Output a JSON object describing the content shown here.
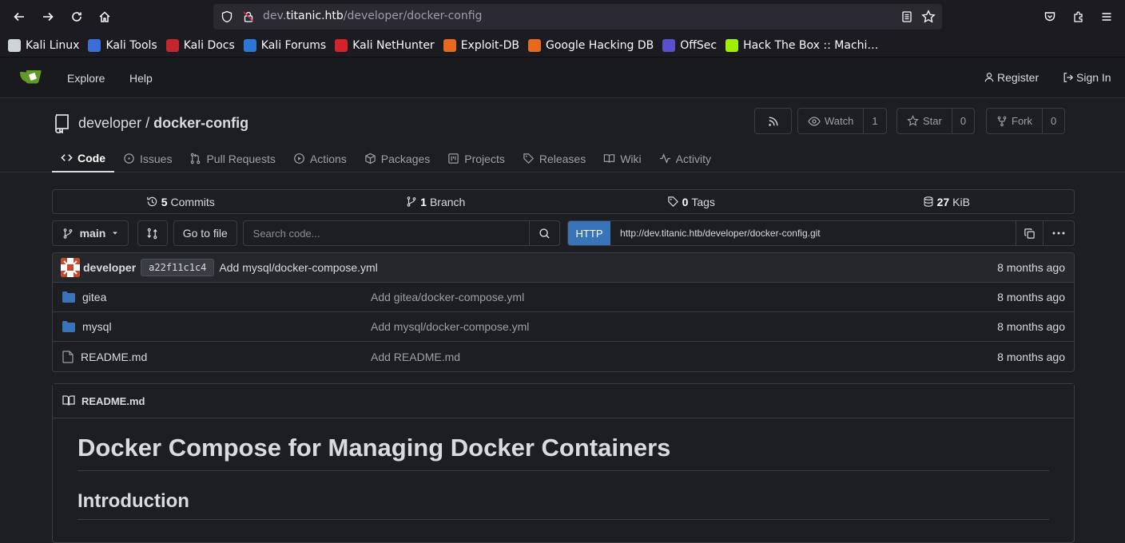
{
  "browser": {
    "url_prefix": "dev.",
    "url_host": "titanic.htb",
    "url_path": "/developer/docker-config",
    "bookmarks": [
      {
        "label": "Kali Linux",
        "icon": "kali-dragon-icon",
        "color": "#cfd2d6"
      },
      {
        "label": "Kali Tools",
        "icon": "kali-tools-icon",
        "color": "#3b6fd8"
      },
      {
        "label": "Kali Docs",
        "icon": "kali-docs-icon",
        "color": "#c1272d"
      },
      {
        "label": "Kali Forums",
        "icon": "kali-forums-icon",
        "color": "#2a78d6"
      },
      {
        "label": "Kali NetHunter",
        "icon": "kali-nethunter-icon",
        "color": "#d3222a"
      },
      {
        "label": "Exploit-DB",
        "icon": "exploit-db-icon",
        "color": "#e66a1a"
      },
      {
        "label": "Google Hacking DB",
        "icon": "ghdb-icon",
        "color": "#e66a1a"
      },
      {
        "label": "OffSec",
        "icon": "offsec-icon",
        "color": "#5a4fcf"
      },
      {
        "label": "Hack The Box :: Machi…",
        "icon": "htb-icon",
        "color": "#9fef00"
      }
    ]
  },
  "gitea": {
    "nav": {
      "explore": "Explore",
      "help": "Help",
      "register": "Register",
      "signin": "Sign In"
    },
    "repo": {
      "owner": "developer",
      "separator": "/",
      "name": "docker-config",
      "watch_label": "Watch",
      "watch_count": "1",
      "star_label": "Star",
      "star_count": "0",
      "fork_label": "Fork",
      "fork_count": "0"
    },
    "tabs": [
      "Code",
      "Issues",
      "Pull Requests",
      "Actions",
      "Packages",
      "Projects",
      "Releases",
      "Wiki",
      "Activity"
    ],
    "stats": {
      "commits_num": "5",
      "commits_label": "Commits",
      "branch_num": "1",
      "branch_label": "Branch",
      "tags_num": "0",
      "tags_label": "Tags",
      "size_num": "27",
      "size_label": "KiB"
    },
    "toolbar": {
      "branch": "main",
      "goto_file": "Go to file",
      "search_placeholder": "Search code...",
      "protocol": "HTTP",
      "clone_url": "http://dev.titanic.htb/developer/docker-config.git"
    },
    "latest_commit": {
      "author": "developer",
      "sha": "a22f11c1c4",
      "message": "Add mysql/docker-compose.yml",
      "time": "8 months ago"
    },
    "files": [
      {
        "name": "gitea",
        "type": "folder",
        "message": "Add gitea/docker-compose.yml",
        "time": "8 months ago"
      },
      {
        "name": "mysql",
        "type": "folder",
        "message": "Add mysql/docker-compose.yml",
        "time": "8 months ago"
      },
      {
        "name": "README.md",
        "type": "file",
        "message": "Add README.md",
        "time": "8 months ago"
      }
    ],
    "readme": {
      "filename": "README.md",
      "h1": "Docker Compose for Managing Docker Containers",
      "h2": "Introduction"
    }
  },
  "colors": {
    "accent": "#3a74b8",
    "folder": "#3a74b8",
    "logo": "#609926"
  }
}
